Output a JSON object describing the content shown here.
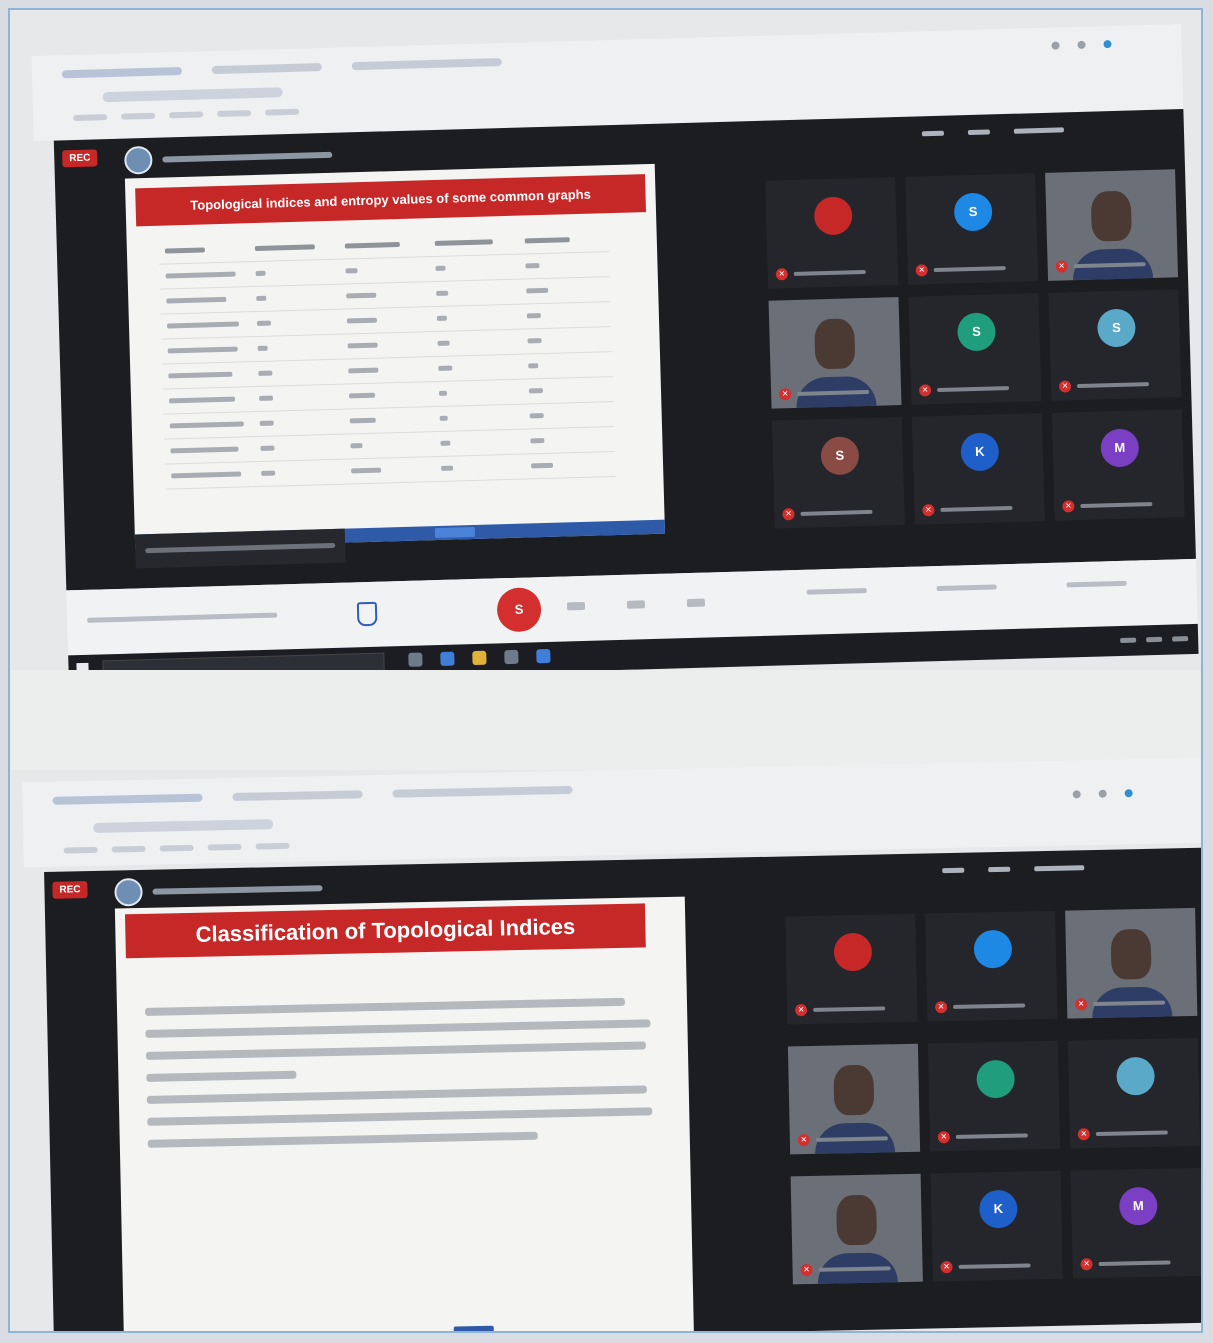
{
  "top_screenshot": {
    "meet_badge": "REC",
    "slide_title": "Topological indices and entropy values of some common graphs",
    "leave_button_initial": "S",
    "participants": [
      {
        "type": "avatar",
        "initial": "",
        "color": "#c62828"
      },
      {
        "type": "avatar",
        "initial": "S",
        "color": "#1e88e5"
      },
      {
        "type": "video"
      },
      {
        "type": "video"
      },
      {
        "type": "avatar",
        "initial": "S",
        "color": "#1f9d7c"
      },
      {
        "type": "avatar",
        "initial": "S",
        "color": "#5aa9c9"
      },
      {
        "type": "avatar",
        "initial": "S",
        "color": "#8a4b45"
      },
      {
        "type": "avatar",
        "initial": "K",
        "color": "#1e5fc9"
      },
      {
        "type": "avatar",
        "initial": "M",
        "color": "#7b3fc4"
      }
    ]
  },
  "bottom_screenshot": {
    "meet_badge": "REC",
    "slide_title": "Classification of Topological Indices",
    "participants": [
      {
        "type": "avatar",
        "initial": "",
        "color": "#c62828"
      },
      {
        "type": "avatar",
        "initial": "",
        "color": "#1e88e5"
      },
      {
        "type": "video"
      },
      {
        "type": "video"
      },
      {
        "type": "avatar",
        "initial": "",
        "color": "#1f9d7c"
      },
      {
        "type": "avatar",
        "initial": "",
        "color": "#5aa9c9"
      },
      {
        "type": "video"
      },
      {
        "type": "avatar",
        "initial": "K",
        "color": "#1e5fc9"
      },
      {
        "type": "avatar",
        "initial": "M",
        "color": "#7b3fc4"
      }
    ]
  },
  "colors": {
    "accent_red": "#c62828",
    "meet_dark": "#1c1d21",
    "slide_bg": "#f4f4f2"
  }
}
